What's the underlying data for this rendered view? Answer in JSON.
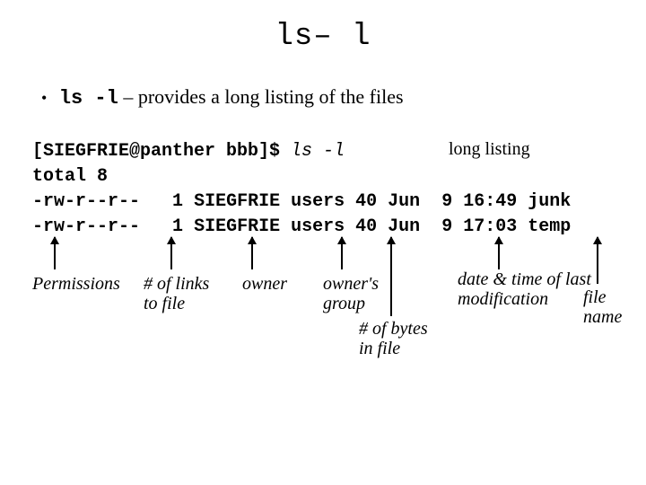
{
  "title": "ls– l",
  "bullet": {
    "cmd": "ls -l",
    "desc": " – provides a long listing of the files"
  },
  "terminal": {
    "prompt": "[SIEGFRIE@panther bbb]$ ",
    "command": "ls -l",
    "total_line": "total 8",
    "rows": [
      {
        "perm": "-rw-r--r--",
        "links": "1",
        "owner": "SIEGFRIE",
        "group": "users",
        "bytes": "40",
        "month": "Jun",
        "day": "9",
        "time": "16:49",
        "name": "junk"
      },
      {
        "perm": "-rw-r--r--",
        "links": "1",
        "owner": "SIEGFRIE",
        "group": "users",
        "bytes": "40",
        "month": "Jun",
        "day": "9",
        "time": "17:03",
        "name": "temp"
      }
    ]
  },
  "long_listing_label": "long listing",
  "annotations": {
    "permissions": "Permissions",
    "links": "# of links\nto file",
    "owner": "owner",
    "group": "owner's\ngroup",
    "date": "date & time of last\nmodification",
    "bytes": "# of bytes\nin file",
    "fname": "file\nname"
  }
}
